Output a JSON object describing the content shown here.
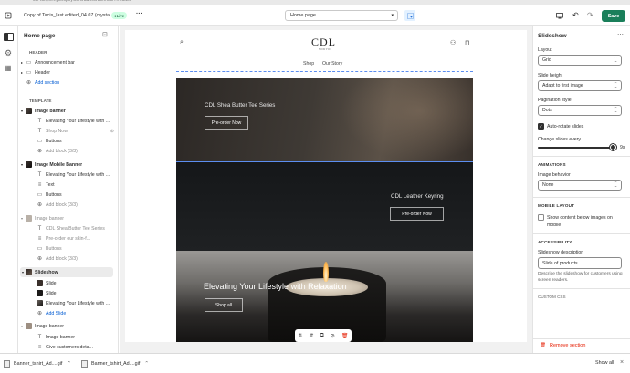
{
  "topbar": {
    "theme_name": "Copy of Tacis_last edited_04.07 (crystal",
    "status_badge": "Live",
    "more_label": "···",
    "page_select": "Home page",
    "save_label": "Save"
  },
  "sidebar": {
    "title": "Home page",
    "header_section": "HEADER",
    "template_section": "TEMPLATE",
    "add_section": "Add section",
    "items": [
      {
        "label": "Announcement bar"
      },
      {
        "label": "Header"
      },
      {
        "label": "Image banner"
      },
      {
        "label": "Elevating Your Lifestyle with ..."
      },
      {
        "label": "Shop Now"
      },
      {
        "label": "Buttons"
      },
      {
        "label": "Add block (3/3)"
      },
      {
        "label": "Image Mobile Banner"
      },
      {
        "label": "Elevating Your Lifestyle with ..."
      },
      {
        "label": "Text"
      },
      {
        "label": "Buttons"
      },
      {
        "label": "Add block (3/3)"
      },
      {
        "label": "Image banner"
      },
      {
        "label": "CDL Shea Butter Tee Series"
      },
      {
        "label": "Pre-order our skin-f..."
      },
      {
        "label": "Buttons"
      },
      {
        "label": "Add block (3/3)"
      },
      {
        "label": "Slideshow"
      },
      {
        "label": "Slide"
      },
      {
        "label": "Slide"
      },
      {
        "label": "Elevating Your Lifestyle with ..."
      },
      {
        "label": "Add Slide"
      },
      {
        "label": "Image banner"
      },
      {
        "label": "Image banner"
      },
      {
        "label": "Give customers deta..."
      }
    ]
  },
  "preview": {
    "brand": "CDL",
    "brand_sub": "TOKYO",
    "nav": [
      "Shop",
      "Our Story"
    ],
    "slide1_title": "CDL Shea Butter Tee Series",
    "slide1_button": "Pre-order Now",
    "slide2_title": "CDL Leather Keyring",
    "slide2_button": "Pre-order Now",
    "slide3_title": "Elevating Your Lifestyle with Relaxation",
    "slide3_button": "Shop all"
  },
  "settings": {
    "title": "Slideshow",
    "layout_label": "Layout",
    "layout_value": "Grid",
    "height_label": "Slide height",
    "height_value": "Adapt to first image",
    "pagination_label": "Pagination style",
    "pagination_value": "Dots",
    "autorotate_label": "Auto-rotate slides",
    "autorotate_checked": true,
    "change_label": "Change slides every",
    "change_value": "9s",
    "animations_header": "ANIMATIONS",
    "image_behavior_label": "Image behavior",
    "image_behavior_value": "None",
    "mobile_header": "MOBILE LAYOUT",
    "mobile_checkbox_label": "Show content below images on mobile",
    "accessibility_header": "ACCESSIBILITY",
    "desc_label": "Slideshow description",
    "desc_value": "Slide of products",
    "desc_help": "Describe the slideshow for customers using screen readers.",
    "custom_css": "CUSTOM CSS",
    "remove_label": "Remove section"
  },
  "downloads": {
    "files": [
      "Banner_tshirt_Ad....gif",
      "Banner_tshirt_Ad....gif"
    ],
    "show_all": "Show all"
  },
  "colors": {
    "accent": "#005bd3",
    "save_bg": "#008060",
    "live_badge": "#29845a",
    "remove": "#e51c00"
  }
}
